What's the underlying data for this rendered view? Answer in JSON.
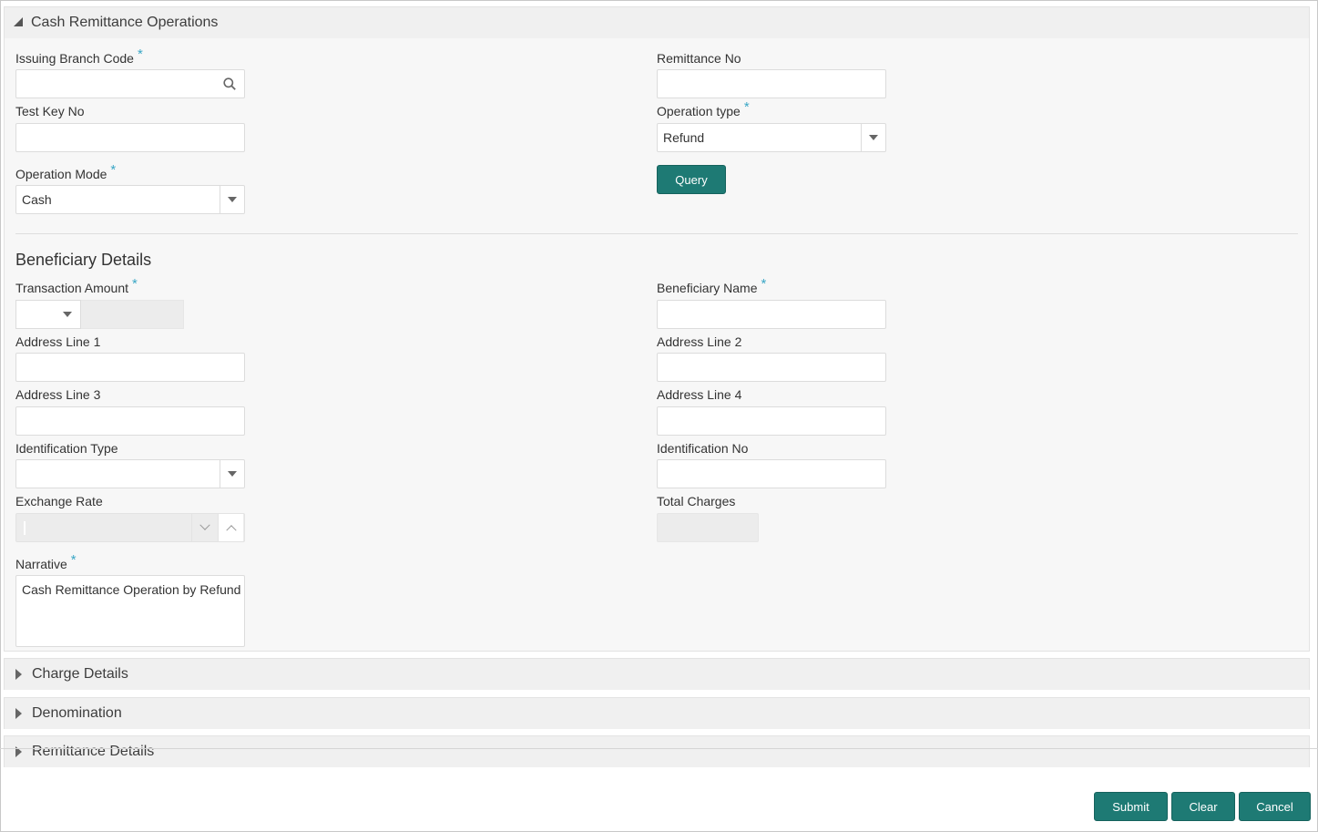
{
  "sections": {
    "main_title": "Cash Remittance Operations",
    "beneficiary_title": "Beneficiary Details",
    "charge_title": "Charge Details",
    "denomination_title": "Denomination",
    "remittance_title": "Remittance Details"
  },
  "fields": {
    "issuing_branch_code": {
      "label": "Issuing Branch Code",
      "value": ""
    },
    "remittance_no": {
      "label": "Remittance No",
      "value": ""
    },
    "test_key_no": {
      "label": "Test Key No",
      "value": ""
    },
    "operation_type": {
      "label": "Operation type",
      "value": "Refund"
    },
    "operation_mode": {
      "label": "Operation Mode",
      "value": "Cash"
    },
    "transaction_amount": {
      "label": "Transaction Amount",
      "currency": "",
      "value": ""
    },
    "beneficiary_name": {
      "label": "Beneficiary Name",
      "value": ""
    },
    "address_line_1": {
      "label": "Address Line 1",
      "value": ""
    },
    "address_line_2": {
      "label": "Address Line 2",
      "value": ""
    },
    "address_line_3": {
      "label": "Address Line 3",
      "value": ""
    },
    "address_line_4": {
      "label": "Address Line 4",
      "value": ""
    },
    "identification_type": {
      "label": "Identification Type",
      "value": ""
    },
    "identification_no": {
      "label": "Identification No",
      "value": ""
    },
    "exchange_rate": {
      "label": "Exchange Rate",
      "value": ""
    },
    "total_charges": {
      "label": "Total Charges",
      "value": ""
    },
    "narrative": {
      "label": "Narrative",
      "value": "Cash Remittance Operation by Refund"
    }
  },
  "required_mark": "*",
  "buttons": {
    "query": "Query",
    "submit": "Submit",
    "clear": "Clear",
    "cancel": "Cancel"
  },
  "colors": {
    "primary_button": "#1e7a74",
    "required_asterisk": "#3ba7c6",
    "panel_background": "#f7f7f7"
  }
}
